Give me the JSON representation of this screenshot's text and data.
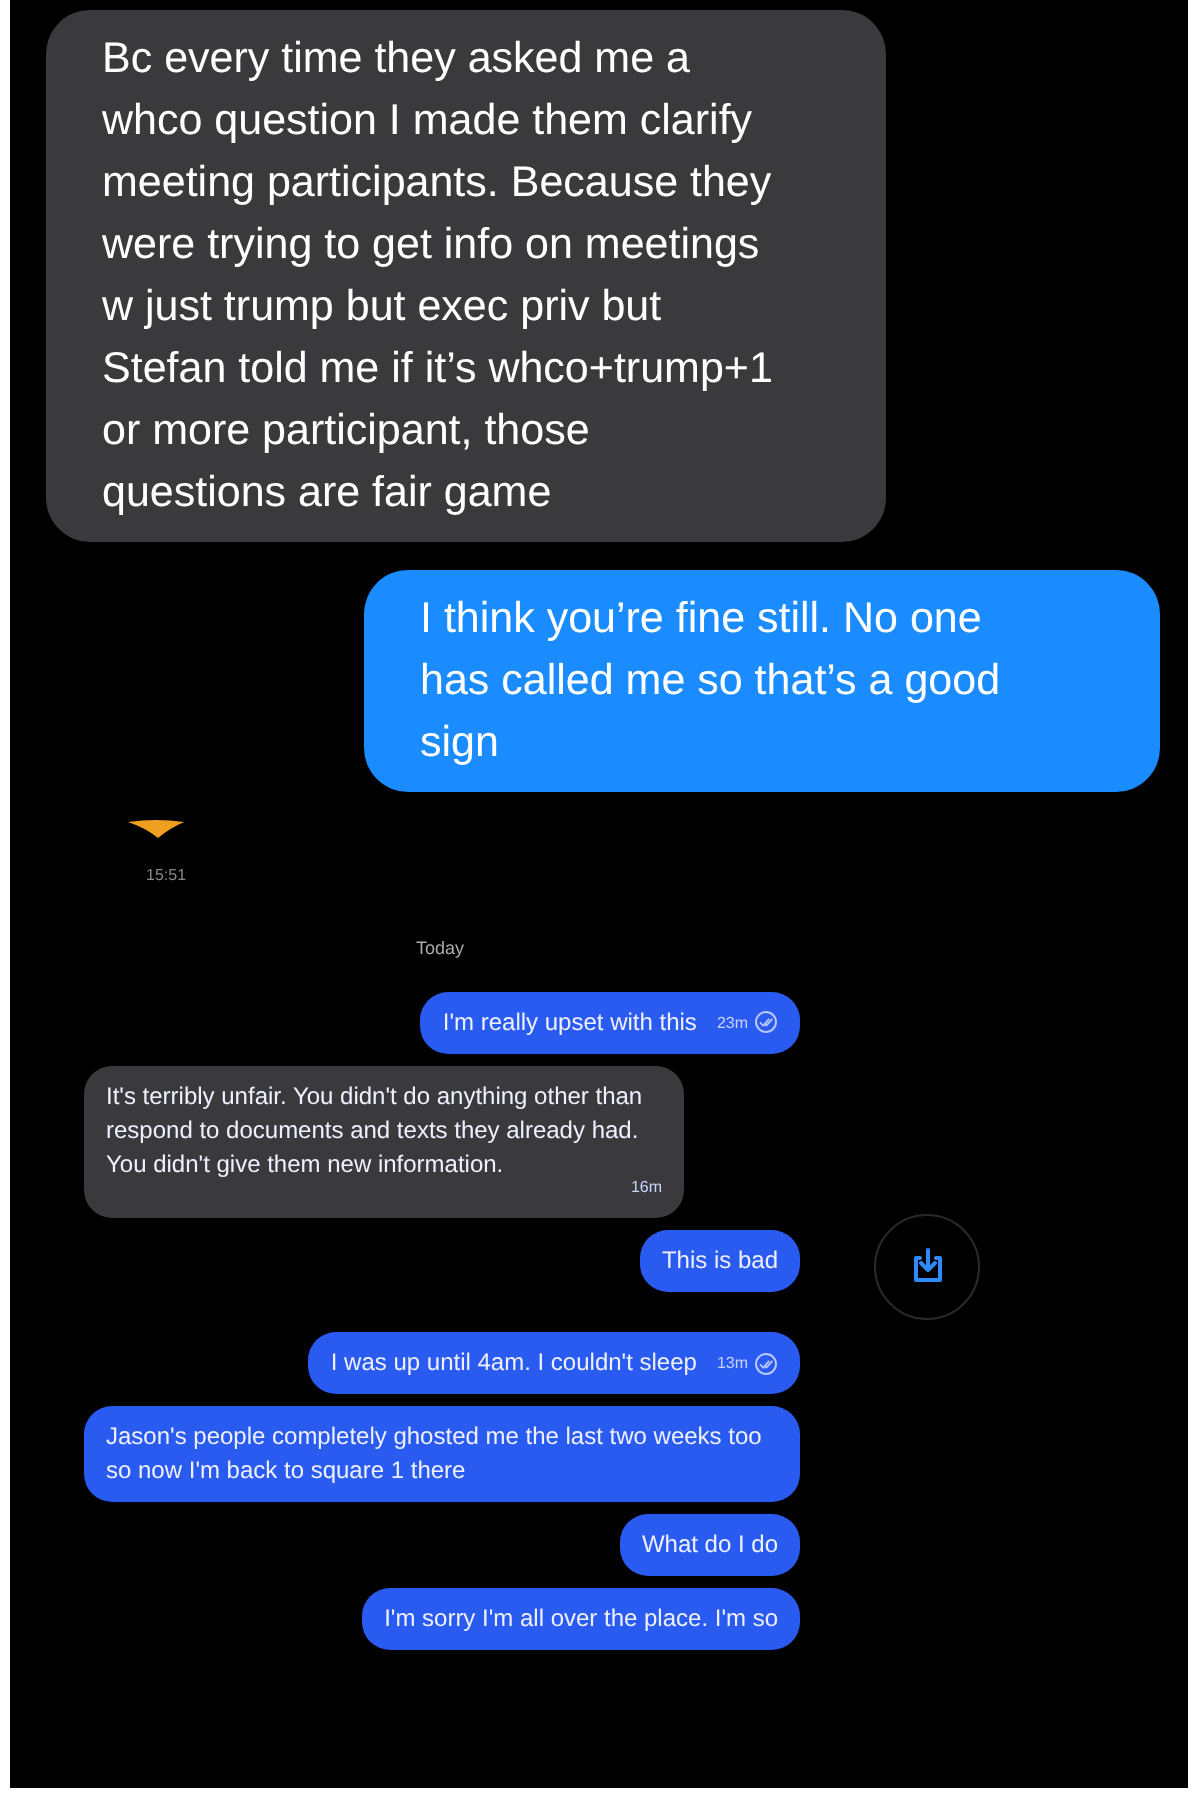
{
  "upper_messages": [
    {
      "kind": "received",
      "text": "Bc every time they asked me a whco question I made them clarify meeting participants. Because they were trying to get info on meetings w just trump but exec priv but Stefan told me if it’s whco+trump+1 or more participant, those questions are fair game"
    },
    {
      "kind": "sent",
      "text": "I think you’re fine still. No one has called me so that’s a good sign"
    }
  ],
  "earlier_time": "15:51",
  "date_divider": "Today",
  "messages": [
    {
      "kind": "sent",
      "text": "I'm really upset with this",
      "time": "23m",
      "seen": true,
      "share": false
    },
    {
      "kind": "received",
      "text": "It's terribly unfair. You didn't do anything other than respond to documents and texts they already had. You didn't give them new information.",
      "time": "16m",
      "seen": false,
      "share": false
    },
    {
      "kind": "sent",
      "text": "This is bad",
      "seen": false,
      "share": true
    },
    {
      "kind": "sent",
      "text": "I was up until 4am. I couldn't sleep",
      "time": "13m",
      "seen": true,
      "share": false
    },
    {
      "kind": "sent",
      "text": "Jason's people completely ghosted me the last two weeks too so now I'm back to square 1 there",
      "seen": false,
      "share": false
    },
    {
      "kind": "sent",
      "text": "What do I do",
      "seen": false,
      "share": false
    },
    {
      "kind": "sent",
      "text": "I'm sorry I'm all over the place. I'm so",
      "seen": false,
      "share": false
    }
  ]
}
